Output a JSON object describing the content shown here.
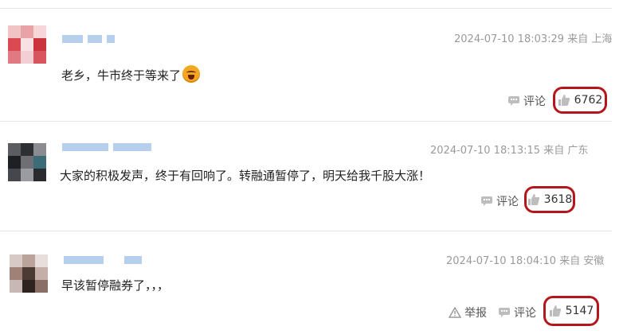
{
  "comments": [
    {
      "timestamp": "2024-07-10 18:03:29 来自 上海",
      "text": "老乡，牛市终于等来了",
      "emoji_icon": "crying-face-icon",
      "reply_label": "评论",
      "like_count": "6762"
    },
    {
      "timestamp": "2024-07-10 18:13:15 来自 广东",
      "text": "大家的积极发声，终于有回响了。转融通暂停了，明天给我千股大涨！",
      "reply_label": "评论",
      "like_count": "3618"
    },
    {
      "timestamp": "2024-07-10 18:04:10 来自 安徽",
      "text": "早该暂停融券了，，，",
      "report_label": "举报",
      "reply_label": "评论",
      "like_count": "5147"
    }
  ],
  "colors": {
    "highlight_border": "#b4161b",
    "username_blur": "#b6cfec",
    "meta_text": "#9a9a9a"
  }
}
